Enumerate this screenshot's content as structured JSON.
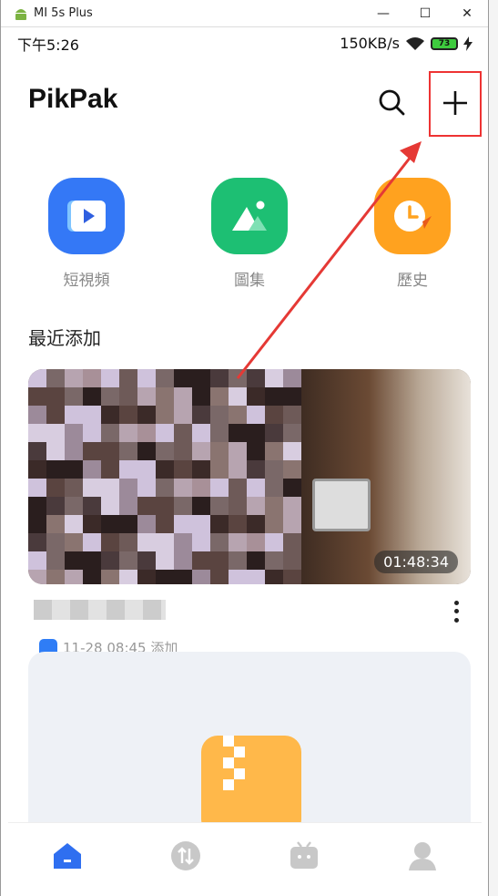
{
  "window": {
    "title": "MI 5s Plus",
    "controls": [
      "—",
      "☐",
      "✕"
    ]
  },
  "statusbar": {
    "time": "下午5:26",
    "speed": "150KB/s",
    "battery": "73"
  },
  "header": {
    "app_title": "PikPak",
    "search_icon": "search-icon",
    "add_icon": "plus-icon"
  },
  "quick_access": [
    {
      "label": "短視頻",
      "color": "#3478F6",
      "icon": "video-icon"
    },
    {
      "label": "圖集",
      "color": "#1DBF73",
      "icon": "gallery-icon"
    },
    {
      "label": "歷史",
      "color": "#FFA21F",
      "icon": "history-icon"
    }
  ],
  "recent": {
    "section_title": "最近添加",
    "video_duration": "01:48:34",
    "meta_text": "11-28 08:45 添加"
  },
  "tabbar": {
    "items": [
      "home-icon",
      "transfer-icon",
      "tv-icon",
      "profile-icon"
    ],
    "active_color": "#2F6FF0",
    "inactive_color": "#C8C8C8"
  },
  "annotation": {
    "highlight_color": "#E53935"
  }
}
